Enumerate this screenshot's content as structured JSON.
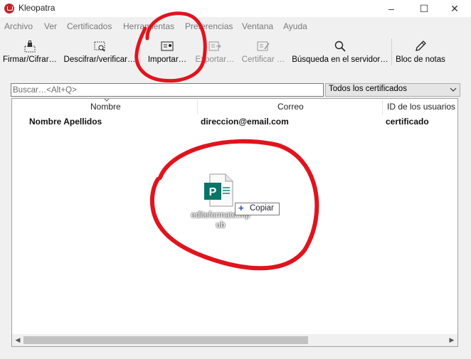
{
  "window": {
    "title": "Kleopatra",
    "controls": [
      "–",
      "☐",
      "✕"
    ]
  },
  "menu": [
    "Archivo",
    "Ver",
    "Certificados",
    "Herramientas",
    "Preferencias",
    "Ventana",
    "Ayuda"
  ],
  "toolbar": {
    "sign_encrypt": "Firmar/Cifrar…",
    "decrypt_verify": "Descifrar/verificar…",
    "import": "Importar…",
    "export": "Exportar…",
    "certify": "Certificar …",
    "lookup": "Búsqueda en el servidor…",
    "notepad": "Bloc de notas"
  },
  "search": {
    "placeholder": "Buscar…<Alt+Q>"
  },
  "filter": {
    "selected": "Todos los certificados"
  },
  "table": {
    "columns": [
      "Nombre",
      "Correo",
      "ID de los usuarios"
    ],
    "rows": [
      {
        "name": "Nombre Apellidos",
        "email": "direccion@email.com",
        "user_ids": "certificado"
      }
    ]
  },
  "drag": {
    "file_name": "editeformato.mp ub",
    "badge_letter": "P",
    "tooltip": "Copiar"
  },
  "colors": {
    "annotation": "#e0141e",
    "publisher_badge": "#077568"
  }
}
